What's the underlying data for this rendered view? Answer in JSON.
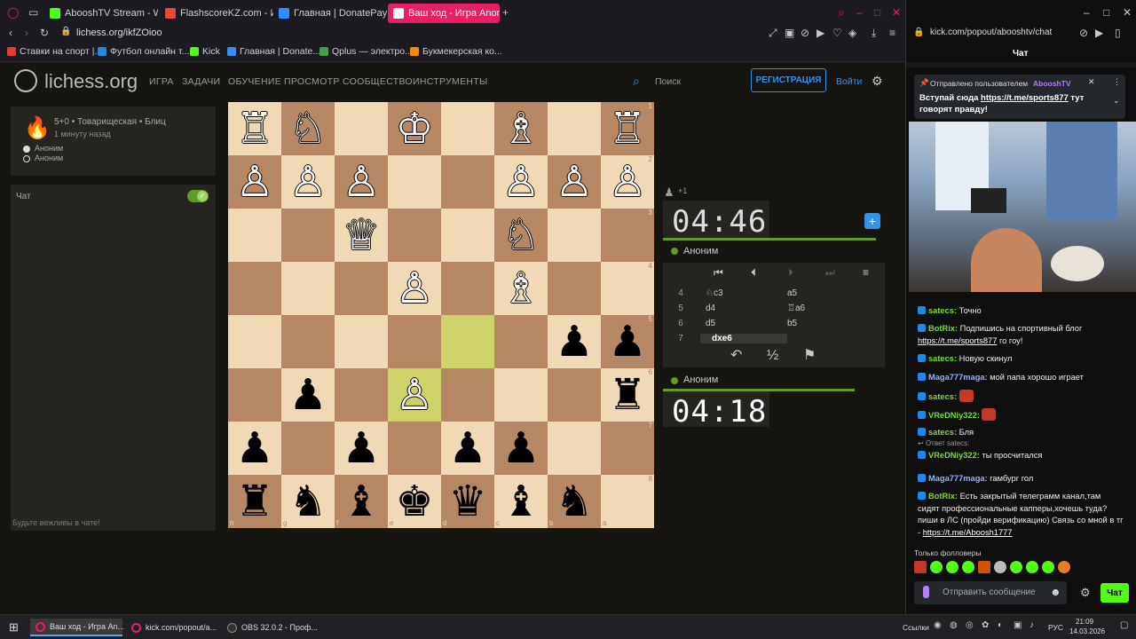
{
  "browser_left": {
    "tabs": [
      {
        "label": "AbooshTV Stream - Watch",
        "color": "#53fc18"
      },
      {
        "label": "FlashscoreKZ.com - Избр",
        "color": "#e34a3d"
      },
      {
        "label": "Главная | DonatePay",
        "color": "#3a8bff"
      },
      {
        "label": "Ваш ход - Игра Anon. • li",
        "color": "#ffffff"
      }
    ],
    "url": "lichess.org/ikfZOioo",
    "bookmarks": [
      "Ставки на спорт |...",
      "Футбол онлайн т...",
      "Kick",
      "Главная | Donate...",
      "Qplus — электро...",
      "Букмекерская ко..."
    ]
  },
  "lichess": {
    "logo": "lichess.org",
    "nav": [
      "ИГРА",
      "ЗАДАЧИ",
      "ОБУЧЕНИЕ",
      "ПРОСМОТР",
      "СООБЩЕСТВО",
      "ИНСТРУМЕНТЫ"
    ],
    "search_placeholder": "Поиск",
    "register": "РЕГИСТРАЦИЯ",
    "login": "Войти",
    "game": {
      "info": "5+0 • Товарищеская • Блиц",
      "time_ago": "1 минуту назад",
      "player_white": "Аноним",
      "player_black": "Аноним"
    },
    "chat_label": "Чат",
    "chat_placeholder": "Будьте вежливы в чате!",
    "spectators": "+1",
    "clock_top": "04:46",
    "clock_bottom": "04:18",
    "player_top": "Аноним",
    "player_bottom": "Аноним",
    "moves": [
      {
        "n": "4",
        "w": "♘c3",
        "b": "a5"
      },
      {
        "n": "5",
        "w": "d4",
        "b": "♖a6"
      },
      {
        "n": "6",
        "w": "d5",
        "b": "b5"
      },
      {
        "n": "7",
        "w": "dxe6",
        "b": ""
      }
    ],
    "board": [
      [
        "wR",
        "wN",
        "",
        "wK",
        "",
        "wB",
        "",
        "wR"
      ],
      [
        "wP",
        "wP",
        "wP",
        "",
        "",
        "wP",
        "wP",
        "wP"
      ],
      [
        "",
        "",
        "wQ",
        "",
        "",
        "wN",
        "",
        ""
      ],
      [
        "",
        "",
        "",
        "wP",
        "",
        "wB",
        "",
        ""
      ],
      [
        "",
        "",
        "",
        "",
        "",
        "",
        "bP",
        "bP"
      ],
      [
        "",
        "bP",
        "",
        "wP",
        "",
        "",
        "",
        "bR"
      ],
      [
        "bP",
        "",
        "bP",
        "",
        "bP",
        "bP",
        "",
        ""
      ],
      [
        "bR",
        "bN",
        "bB",
        "bK",
        "bQ",
        "bB",
        "bN",
        ""
      ]
    ],
    "ranks": [
      "1",
      "2",
      "3",
      "4",
      "5",
      "6",
      "7",
      "8"
    ],
    "files": [
      "h",
      "g",
      "f",
      "e",
      "d",
      "c",
      "b",
      "a"
    ]
  },
  "browser_right": {
    "url": "kick.com/popout/abooshtv/chat",
    "title": "Чат",
    "pinned_by": "Отправлено пользователем",
    "pinned_user": "AbooshTV",
    "pinned_text_1": "Вступай сюда ",
    "pinned_link": "https://t.me/sports877",
    "pinned_text_2": " тут говорят правду!",
    "messages": [
      {
        "user": "satecs:",
        "text": "Точно",
        "g": true
      },
      {
        "user": "BotRix:",
        "text": "Подпишись на спортивный блог",
        "link": "https://t.me/sports877",
        "after": " го гоу!",
        "g": true
      },
      {
        "user": "satecs:",
        "text": "Новую скинул",
        "g": true
      },
      {
        "user": "Maga777maga:",
        "text": "мой папа хорошо играет",
        "g": false
      },
      {
        "user": "satecs:",
        "text": "",
        "g": true
      },
      {
        "user": "VReDNiy322:",
        "text": "",
        "g": true
      },
      {
        "user": "satecs:",
        "text": "Бля",
        "g": true
      },
      {
        "reply": "Ответ satecs:",
        "user": "VReDNiy322:",
        "text": "ты просчитался",
        "g": true
      },
      {
        "user": "Maga777maga:",
        "text": "гамбург гол",
        "g": false
      },
      {
        "user": "BotRix:",
        "text": "Есть закрытый телеграмм канал,там сидят профессиональные капперы,хочешь туда? пиши в ЛС (пройди верификацию) Связь со мной в тг - ",
        "link": "https://t.me/Aboosh1777",
        "g": true
      }
    ],
    "followers_only": "Только фолловеры",
    "send_placeholder": "Отправить сообщение",
    "chat_button": "Чат"
  },
  "taskbar": {
    "items": [
      "Ваш ход - Игра An...",
      "kick.com/popout/a...",
      "OBS 32.0.2 - Проф..."
    ],
    "links": "Ссылки",
    "lang": "РУС",
    "time": "21:09",
    "date": "14.03.2026"
  },
  "colors": {
    "accent": "#629924",
    "kick_green": "#53fc18",
    "tab_active": "#e91e63"
  }
}
